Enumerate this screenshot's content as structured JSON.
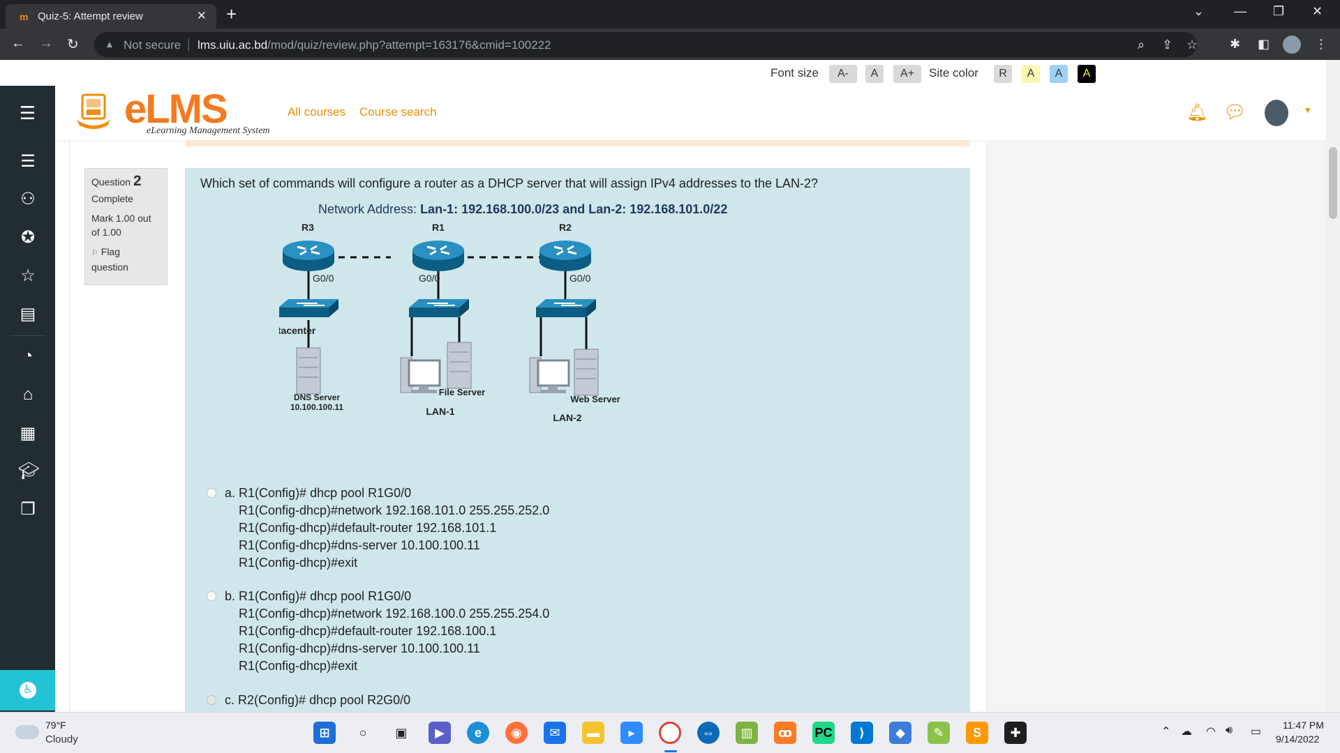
{
  "browser": {
    "tab_title": "Quiz-5: Attempt review",
    "tab_close": "✕",
    "new_tab": "+",
    "security_label": "Not secure",
    "url_host": "lms.uiu.ac.bd",
    "url_path": "/mod/quiz/review.php?attempt=163176&cmid=100222"
  },
  "accessibility": {
    "font_size_label": "Font size",
    "font_buttons": [
      "A-",
      "A",
      "A+"
    ],
    "site_color_label": "Site color",
    "color_buttons": [
      "R",
      "A",
      "A",
      "A"
    ]
  },
  "header": {
    "logo_text": "eLMS",
    "logo_tagline": "eLearning Management System",
    "links": [
      "All courses",
      "Course search"
    ]
  },
  "question_info": {
    "label": "Question",
    "number": "2",
    "state": "Complete",
    "grade": "Mark 1.00 out of 1.00",
    "flag": "Flag question"
  },
  "question": {
    "text": "Which set of commands will configure a router as a DHCP server that will assign IPv4  addresses to the LAN-2?",
    "network_label": "Network Address: ",
    "network_value": "Lan-1: 192.168.100.0/23 and Lan-2: 192.168.101.0/22",
    "diagram": {
      "routers": [
        "R3",
        "R1",
        "R2"
      ],
      "interfaces": [
        "G0/0",
        "G0/0",
        "G0/0"
      ],
      "datacenter": "Datacenter",
      "dns_server": "DNS Server",
      "dns_ip": "10.100.100.11",
      "file_server": "File Server",
      "web_server": "Web Server",
      "lan1": "LAN-1",
      "lan2": "LAN-2"
    },
    "answers": [
      {
        "letter": "a.",
        "lines": [
          "R1(Config)# dhcp pool R1G0/0",
          "R1(Config-dhcp)#network 192.168.101.0 255.255.252.0",
          "R1(Config-dhcp)#default-router 192.168.101.1",
          "R1(Config-dhcp)#dns-server 10.100.100.11",
          "R1(Config-dhcp)#exit"
        ]
      },
      {
        "letter": "b.",
        "lines": [
          "R1(Config)# dhcp pool R1G0/0",
          "R1(Config-dhcp)#network 192.168.100.0 255.255.254.0",
          "R1(Config-dhcp)#default-router 192.168.100.1",
          "R1(Config-dhcp)#dns-server 10.100.100.11",
          "R1(Config-dhcp)#exit"
        ]
      },
      {
        "letter": "c.",
        "lines": [
          "R2(Config)# dhcp pool R2G0/0"
        ]
      }
    ]
  },
  "taskbar": {
    "weather_temp": "79°F",
    "weather_desc": "Cloudy",
    "time": "11:47 PM",
    "date": "9/14/2022"
  },
  "colors": {
    "accent": "#f08c00",
    "sidebar": "#222d32",
    "question_bg": "#cfe7ea"
  }
}
